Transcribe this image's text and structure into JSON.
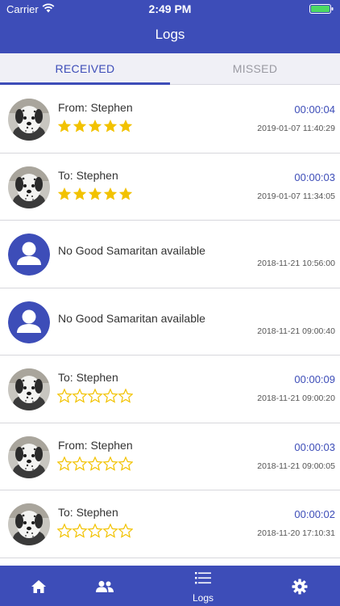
{
  "status_bar": {
    "carrier": "Carrier",
    "time": "2:49 PM"
  },
  "header": {
    "title": "Logs"
  },
  "tabs": [
    {
      "label": "RECEIVED",
      "selected": true
    },
    {
      "label": "MISSED",
      "selected": false
    }
  ],
  "logs": [
    {
      "avatar": "dalmatian-photo",
      "name": "From: Stephen",
      "rating": 5,
      "duration": "00:00:04",
      "timestamp": "2019-01-07 11:40:29"
    },
    {
      "avatar": "dalmatian-photo",
      "name": "To: Stephen",
      "rating": 5,
      "duration": "00:00:03",
      "timestamp": "2019-01-07 11:34:05"
    },
    {
      "avatar": "default-user-icon",
      "name": "No Good Samaritan available",
      "rating": null,
      "duration": "",
      "timestamp": "2018-11-21 10:56:00"
    },
    {
      "avatar": "default-user-icon",
      "name": "No Good Samaritan available",
      "rating": null,
      "duration": "",
      "timestamp": "2018-11-21 09:00:40"
    },
    {
      "avatar": "dalmatian-photo",
      "name": "To: Stephen",
      "rating": 0,
      "duration": "00:00:09",
      "timestamp": "2018-11-21 09:00:20"
    },
    {
      "avatar": "dalmatian-photo",
      "name": "From: Stephen",
      "rating": 0,
      "duration": "00:00:03",
      "timestamp": "2018-11-21 09:00:05"
    },
    {
      "avatar": "dalmatian-photo",
      "name": "To: Stephen",
      "rating": 0,
      "duration": "00:00:02",
      "timestamp": "2018-11-20 17:10:31"
    }
  ],
  "bottom_nav": [
    {
      "icon": "home-icon",
      "label": ""
    },
    {
      "icon": "people-icon",
      "label": ""
    },
    {
      "icon": "list-icon",
      "label": "Logs",
      "selected": true
    },
    {
      "icon": "gear-icon",
      "label": ""
    }
  ],
  "colors": {
    "primary": "#3d4db8",
    "star_filled": "#f2c200",
    "star_empty": "#f2c200"
  }
}
